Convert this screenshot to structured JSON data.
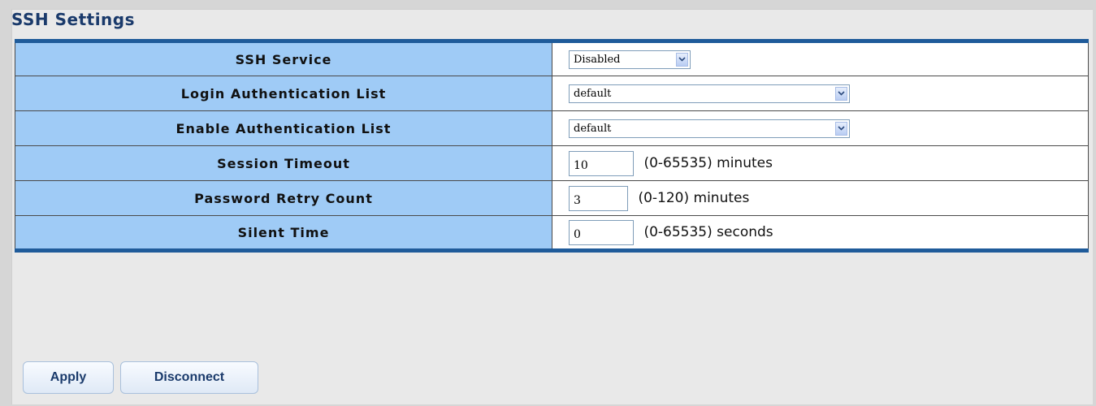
{
  "page": {
    "title": "SSH Settings"
  },
  "settings": {
    "ssh_service": {
      "label": "SSH Service",
      "value": "Disabled"
    },
    "login_auth_list": {
      "label": "Login Authentication List",
      "value": "default"
    },
    "enable_auth_list": {
      "label": "Enable Authentication List",
      "value": "default"
    },
    "session_timeout": {
      "label": "Session Timeout",
      "value": "10",
      "unit": "(0-65535) minutes"
    },
    "password_retry": {
      "label": "Password Retry Count",
      "value": "3",
      "unit": "(0-120) minutes"
    },
    "silent_time": {
      "label": "Silent Time",
      "value": "0",
      "unit": "(0-65535) seconds"
    }
  },
  "buttons": {
    "apply": "Apply",
    "disconnect": "Disconnect"
  },
  "colors": {
    "label_bg": "#9fcbf6",
    "table_border_accent": "#1f5b9a",
    "title_color": "#1a3a6b"
  },
  "icons": {
    "dropdown": "chevron-down-icon"
  }
}
